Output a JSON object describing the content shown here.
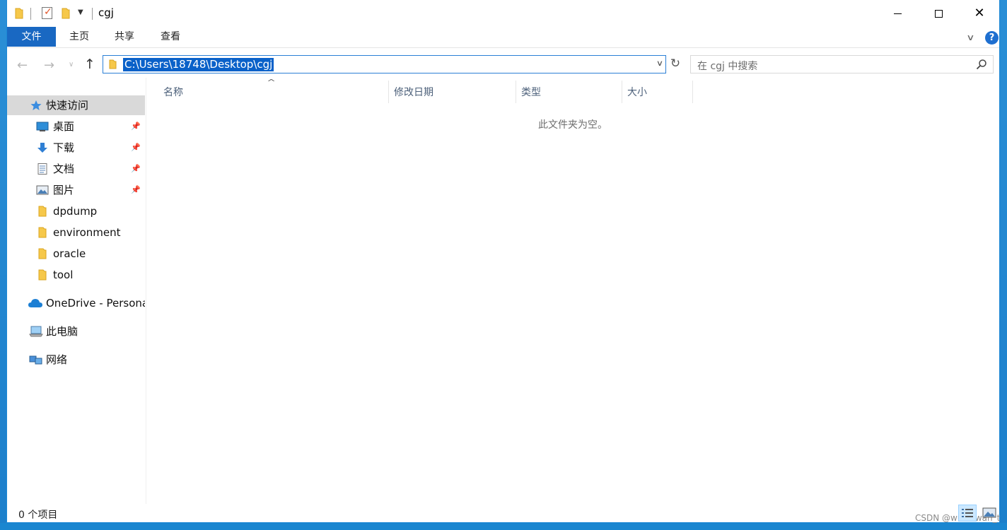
{
  "window": {
    "title": "cgj"
  },
  "ribbon": {
    "tabs": [
      "文件",
      "主页",
      "共享",
      "查看"
    ],
    "accent": "#1968c2"
  },
  "address": {
    "path": "C:\\Users\\18748\\Desktop\\cgj",
    "search_placeholder": "在 cgj 中搜索"
  },
  "sidebar": {
    "items": [
      {
        "label": "快速访问",
        "icon": "star-icon"
      },
      {
        "label": "桌面",
        "icon": "desktop-icon",
        "pinned": true
      },
      {
        "label": "下载",
        "icon": "download-icon",
        "pinned": true
      },
      {
        "label": "文档",
        "icon": "document-icon",
        "pinned": true
      },
      {
        "label": "图片",
        "icon": "picture-icon",
        "pinned": true
      },
      {
        "label": "dpdump",
        "icon": "folder-icon"
      },
      {
        "label": "environment",
        "icon": "folder-icon"
      },
      {
        "label": "oracle",
        "icon": "folder-icon"
      },
      {
        "label": "tool",
        "icon": "folder-icon"
      },
      {
        "label": "OneDrive - Persona",
        "icon": "cloud-icon"
      },
      {
        "label": "此电脑",
        "icon": "computer-icon"
      },
      {
        "label": "网络",
        "icon": "network-icon"
      }
    ]
  },
  "columns": [
    "名称",
    "修改日期",
    "类型",
    "大小"
  ],
  "content": {
    "empty_message": "此文件夹为空。"
  },
  "status": {
    "item_count": "0 个项目"
  },
  "watermark": "CSDN @wuwuwan_t"
}
